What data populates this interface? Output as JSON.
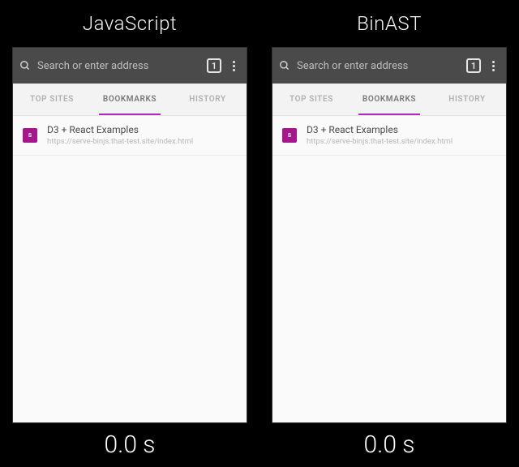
{
  "panes": [
    {
      "title": "JavaScript",
      "timer": "0.0 s"
    },
    {
      "title": "BinAST",
      "timer": "0.0 s"
    }
  ],
  "browser": {
    "search_placeholder": "Search or enter address",
    "tab_count": "1",
    "tabs": [
      {
        "label": "TOP SITES"
      },
      {
        "label": "BOOKMARKS"
      },
      {
        "label": "HISTORY"
      }
    ],
    "bookmark": {
      "favicon_letter": "s",
      "title": "D3 + React Examples",
      "url": "https://serve-binjs.that-test.site/index.html"
    }
  }
}
